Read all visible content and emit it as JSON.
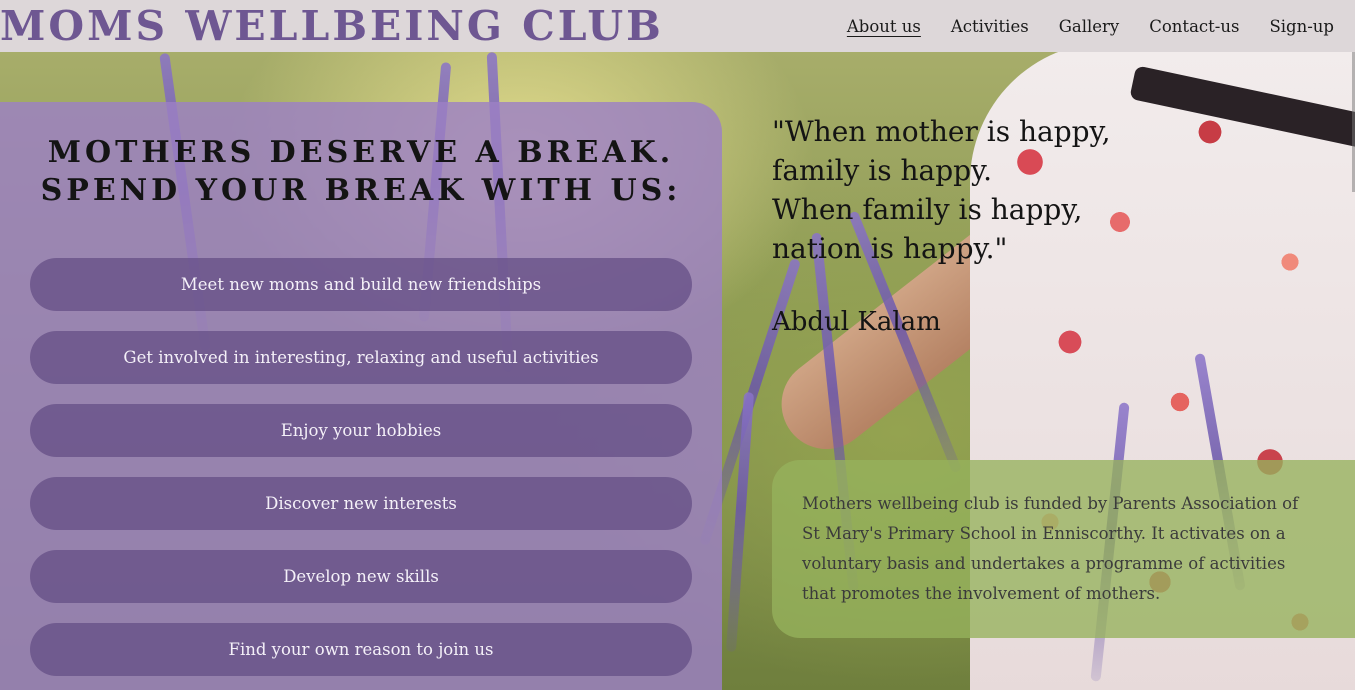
{
  "header": {
    "logo": "MOMS WELLBEING CLUB",
    "nav": [
      {
        "label": "About us",
        "active": true
      },
      {
        "label": "Activities",
        "active": false
      },
      {
        "label": "Gallery",
        "active": false
      },
      {
        "label": "Contact-us",
        "active": false
      },
      {
        "label": "Sign-up",
        "active": false
      }
    ]
  },
  "hero": {
    "headline_line1": "MOTHERS DESERVE A BREAK.",
    "headline_line2": "SPEND YOUR BREAK WITH US:",
    "benefits": [
      "Meet new moms and build new friendships",
      "Get involved in interesting, relaxing and useful activities",
      "Enjoy your hobbies",
      "Discover new interests",
      "Develop new skills",
      "Find your own reason to join us"
    ]
  },
  "quote": {
    "lines": [
      "\"When mother is happy,",
      "family is happy.",
      "When family is happy,",
      "nation is happy.\""
    ],
    "author": "Abdul Kalam"
  },
  "info": {
    "text": "Mothers wellbeing club is funded by Parents Association of St Mary's Primary School in Enniscorthy. It activates on a voluntary basis and undertakes a programme of activities that promotes the involvement of mothers."
  },
  "colors": {
    "logo": "#6e5792",
    "header_bg": "#ddd7d9",
    "panel": "#9c80c4",
    "pill": "#624c84",
    "info_box": "#96b25c"
  }
}
